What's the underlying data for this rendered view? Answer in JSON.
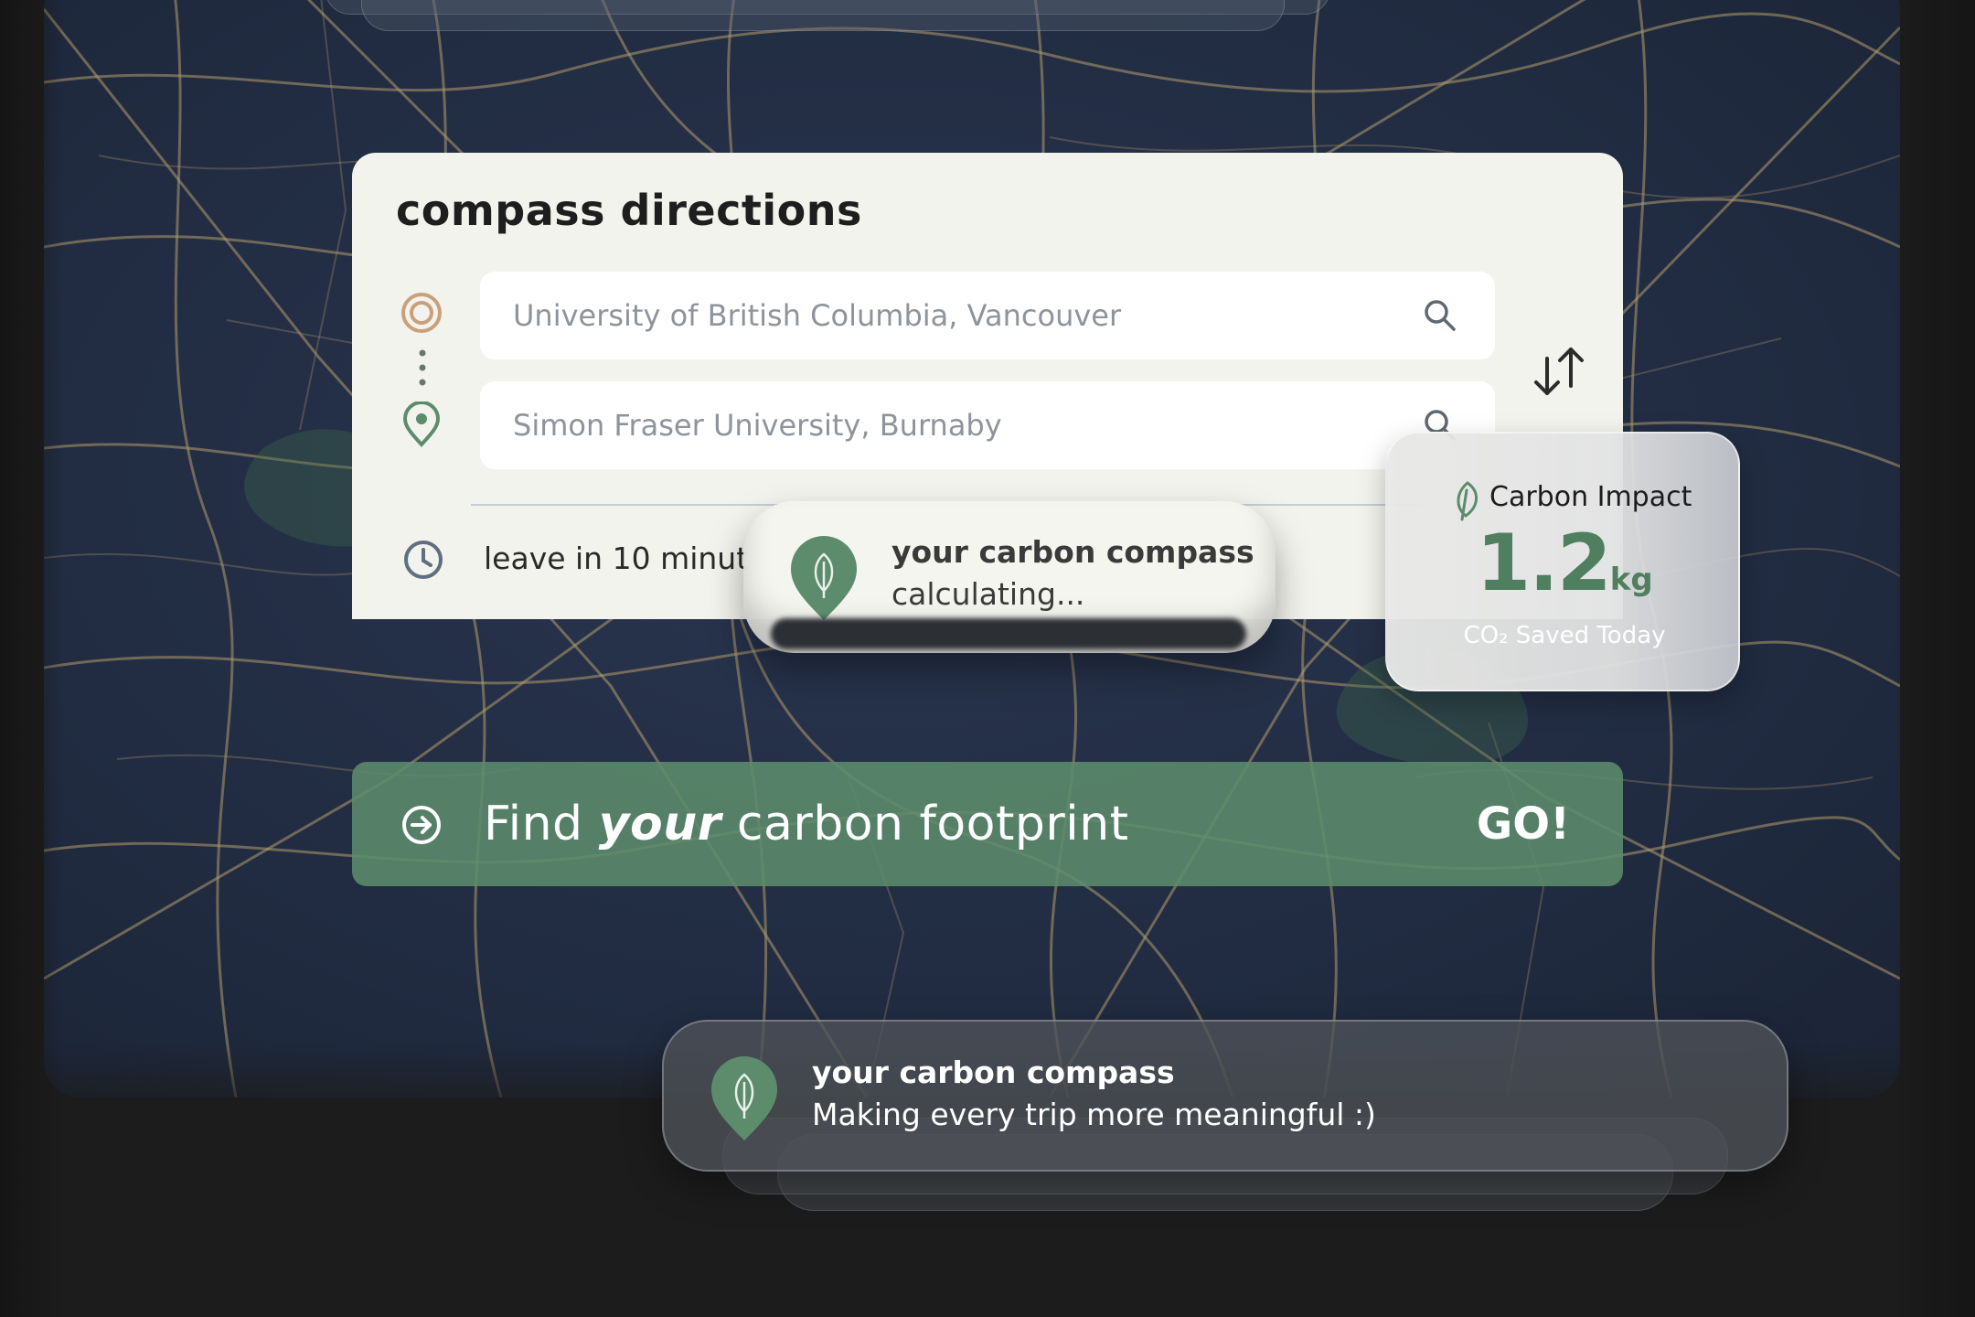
{
  "directions": {
    "title": "compass directions",
    "origin_value": "University of British Columbia, Vancouver",
    "destination_value": "Simon Fraser University, Burnaby",
    "leave_time": "leave in 10 minut"
  },
  "calc_toast": {
    "title": "your carbon compass",
    "subtitle": "calculating..."
  },
  "impact": {
    "title": "Carbon Impact",
    "value": "1.2",
    "unit": "kg",
    "caption": "CO₂ Saved Today"
  },
  "go_bar": {
    "label_pre": "Find ",
    "label_em": "your",
    "label_post": " carbon footprint",
    "cta": "GO!"
  },
  "notification": {
    "title": "your carbon compass",
    "message": "Making every trip more meaningful :)"
  },
  "colors": {
    "accent_green": "#5c8c6c",
    "origin_marker": "#c9a07a",
    "panel_bg": "#f3f3ee",
    "map_bg": "#212c42",
    "map_roads": "#b39b6c"
  },
  "icons": [
    "origin-target-icon",
    "destination-pin-icon",
    "search-icon",
    "swap-icon",
    "clock-icon",
    "leaf-pin-icon",
    "leaf-icon",
    "arrow-circle-icon"
  ]
}
